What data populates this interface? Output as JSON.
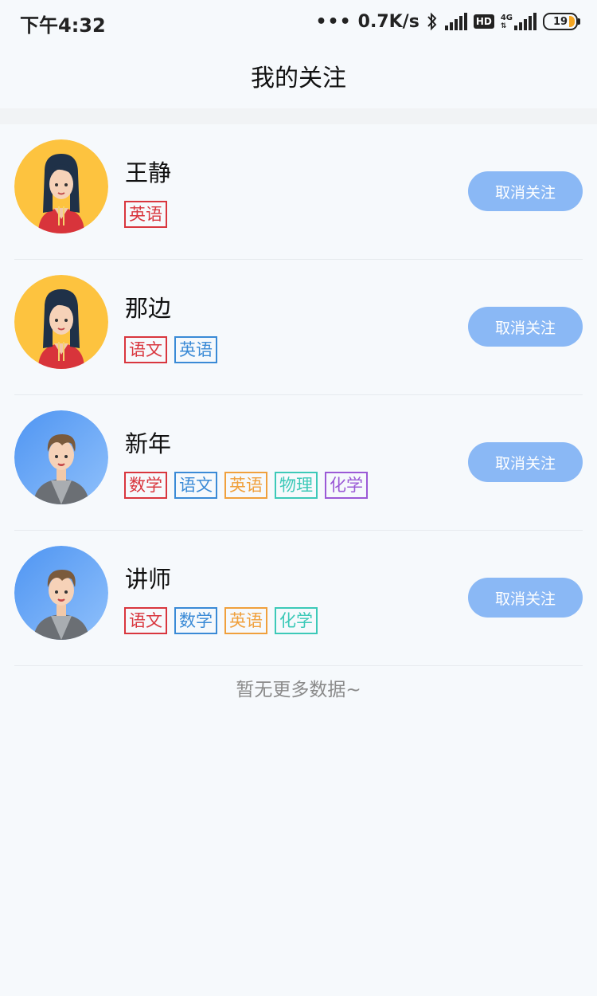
{
  "status": {
    "time": "下午4:32",
    "dots": "•••",
    "speed": "0.7K/s",
    "bluetooth": "bluetooth-icon",
    "hd": "HD",
    "network": "4G",
    "battery": "19"
  },
  "header": {
    "title": "我的关注"
  },
  "follows": [
    {
      "name": "王静",
      "avatar": "girl",
      "tags": [
        {
          "label": "英语",
          "color": "#d9363e"
        }
      ]
    },
    {
      "name": "那边",
      "avatar": "girl",
      "tags": [
        {
          "label": "语文",
          "color": "#d9363e"
        },
        {
          "label": "英语",
          "color": "#3a8ad6"
        }
      ]
    },
    {
      "name": "新年",
      "avatar": "boy",
      "tags": [
        {
          "label": "数学",
          "color": "#d9363e"
        },
        {
          "label": "语文",
          "color": "#3a8ad6"
        },
        {
          "label": "英语",
          "color": "#f0a03c"
        },
        {
          "label": "物理",
          "color": "#3cc9b8"
        },
        {
          "label": "化学",
          "color": "#9b59d6"
        }
      ]
    },
    {
      "name": "讲师",
      "avatar": "boy",
      "tags": [
        {
          "label": "语文",
          "color": "#d9363e"
        },
        {
          "label": "数学",
          "color": "#3a8ad6"
        },
        {
          "label": "英语",
          "color": "#f0a03c"
        },
        {
          "label": "化学",
          "color": "#3cc9b8"
        }
      ]
    }
  ],
  "unfollow_label": "取消关注",
  "footer": {
    "no_more": "暂无更多数据~"
  },
  "colors": {
    "button": "#8ab8f5",
    "background": "#f6f9fc"
  }
}
